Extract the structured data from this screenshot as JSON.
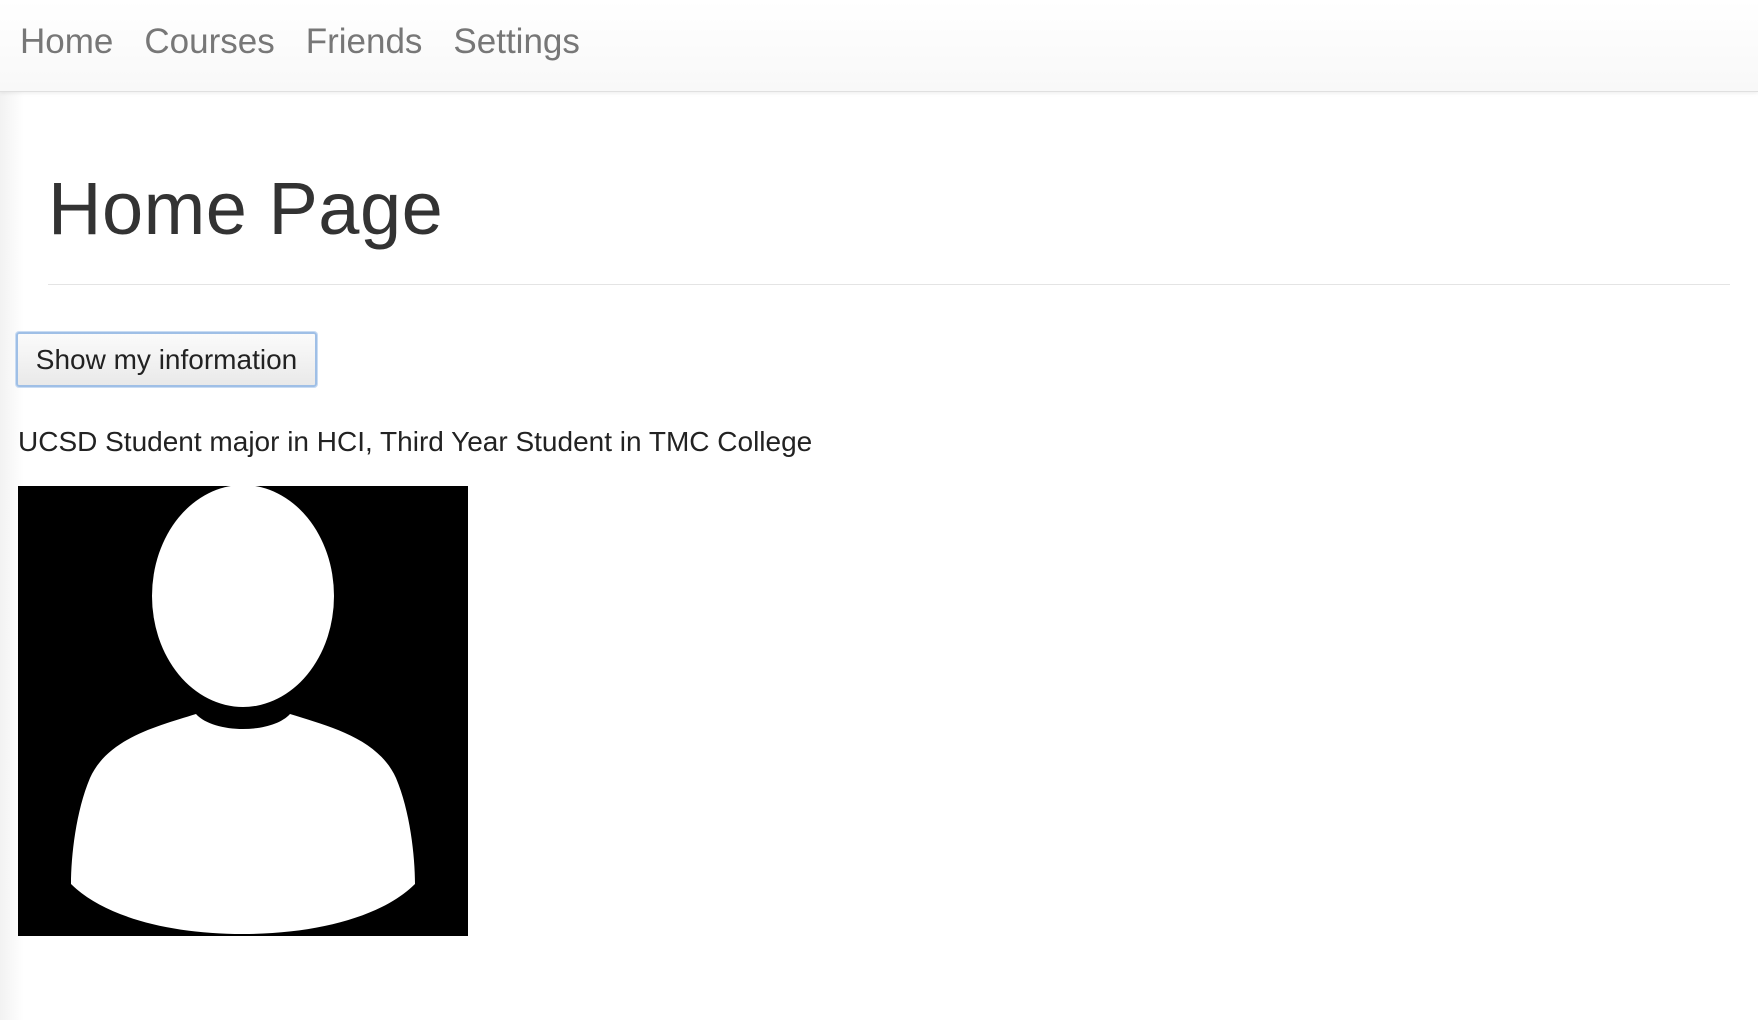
{
  "nav": {
    "items": [
      {
        "label": "Home"
      },
      {
        "label": "Courses"
      },
      {
        "label": "Friends"
      },
      {
        "label": "Settings"
      }
    ]
  },
  "main": {
    "page_title": "Home Page",
    "show_info_button_label": "Show my information",
    "info_text": "UCSD Student major in HCI, Third Year Student in TMC College",
    "avatar_icon": "user-silhouette-icon"
  },
  "colors": {
    "nav_text": "#777777",
    "title_text": "#333333",
    "button_focus_border": "#9fbfe6",
    "avatar_background": "#000000",
    "avatar_foreground": "#ffffff"
  }
}
